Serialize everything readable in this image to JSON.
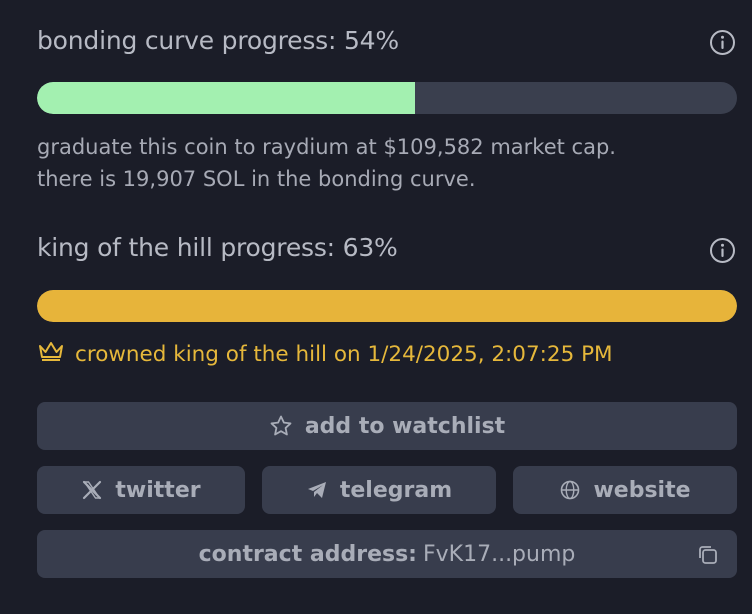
{
  "bonding": {
    "title": "bonding curve progress: 54%",
    "progress_fraction": 0.54,
    "fill_color": "#a3f0b0",
    "line1": "graduate this coin to raydium at $109,582 market cap.",
    "line2": "there is 19,907 SOL in the bonding curve."
  },
  "king": {
    "title": "king of the hill progress: 63%",
    "progress_fraction": 1.0,
    "fill_color": "#e7b43a",
    "crowned_text": "crowned king of the hill on 1/24/2025, 2:07:25 PM"
  },
  "buttons": {
    "watchlist": "add to watchlist",
    "twitter": "twitter",
    "telegram": "telegram",
    "website": "website"
  },
  "contract": {
    "label": "contract address:",
    "value": "FvK17...pump"
  },
  "icons": {
    "info": "info-icon",
    "crown": "crown-icon",
    "star": "star-icon",
    "x": "x-logo-icon",
    "telegram": "paper-plane-icon",
    "globe": "globe-icon",
    "copy": "copy-icon"
  }
}
